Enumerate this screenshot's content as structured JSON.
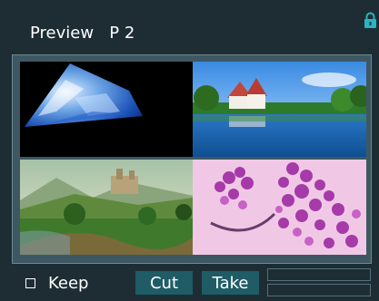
{
  "header": {
    "title": "Preview",
    "page": "P 2"
  },
  "preview": {
    "tiles": [
      {
        "name": "satellite-earth-thumbnail"
      },
      {
        "name": "temple-lake-thumbnail"
      },
      {
        "name": "castle-valley-thumbnail"
      },
      {
        "name": "lilac-flower-thumbnail"
      }
    ]
  },
  "footer": {
    "keep_label": "Keep",
    "keep_checked": false,
    "cut_label": "Cut",
    "take_label": "Take"
  },
  "colors": {
    "background": "#1e2d34",
    "frame": "#3e5863",
    "button": "#1f5c66",
    "lock": "#2bb3c0"
  },
  "icons": {
    "lock": "lock-icon"
  }
}
